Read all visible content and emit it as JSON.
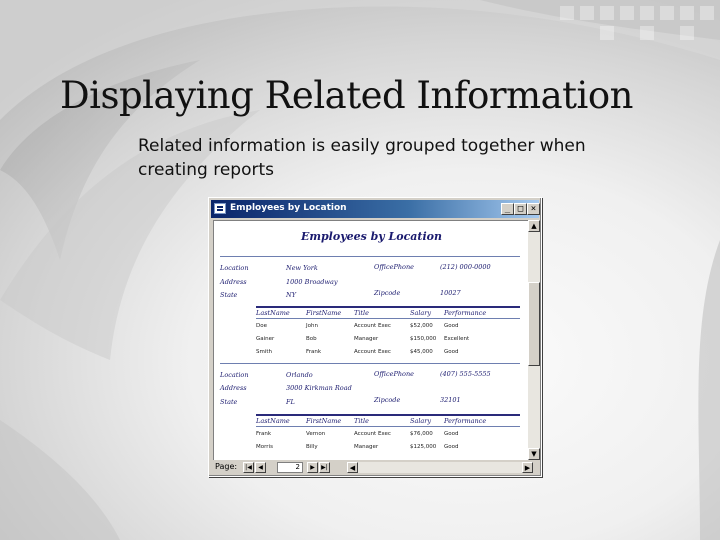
{
  "slide": {
    "title": "Displaying Related Information",
    "body": "Related information is easily grouped together when creating reports"
  },
  "window": {
    "title": "Employees by Location",
    "icon": "report-icon",
    "controls": {
      "minimize": "_",
      "maximize": "□",
      "close": "×"
    }
  },
  "report": {
    "title": "Employees by Location",
    "field_labels": {
      "location": "Location",
      "address": "Address",
      "state": "State",
      "office_phone": "OfficePhone",
      "zipcode": "Zipcode"
    },
    "columns": [
      "LastName",
      "FirstName",
      "Title",
      "Salary",
      "Performance"
    ],
    "groups": [
      {
        "location": "New York",
        "address": "1000 Broadway",
        "state": "NY",
        "office_phone": "(212) 000-0000",
        "zipcode": "10027",
        "rows": [
          [
            "Doe",
            "John",
            "Account Exec",
            "$52,000",
            "Good"
          ],
          [
            "Gainer",
            "Bob",
            "Manager",
            "$150,000",
            "Excellent"
          ],
          [
            "Smith",
            "Frank",
            "Account Exec",
            "$45,000",
            "Good"
          ]
        ]
      },
      {
        "location": "Orlando",
        "address": "3000 Kirkman Road",
        "state": "FL",
        "office_phone": "(407) 555-5555",
        "zipcode": "32101",
        "rows": [
          [
            "Frank",
            "Vernon",
            "Account Exec",
            "$76,000",
            "Good"
          ],
          [
            "Morris",
            "Billy",
            "Manager",
            "$125,000",
            "Good"
          ]
        ]
      }
    ]
  },
  "navigation": {
    "label": "Page:",
    "page": "2",
    "buttons": {
      "first": "|◀",
      "prev": "◀",
      "next": "▶",
      "last": "▶|"
    }
  },
  "scrollbar": {
    "up": "▲",
    "down": "▼",
    "left": "◀",
    "right": "▶"
  }
}
